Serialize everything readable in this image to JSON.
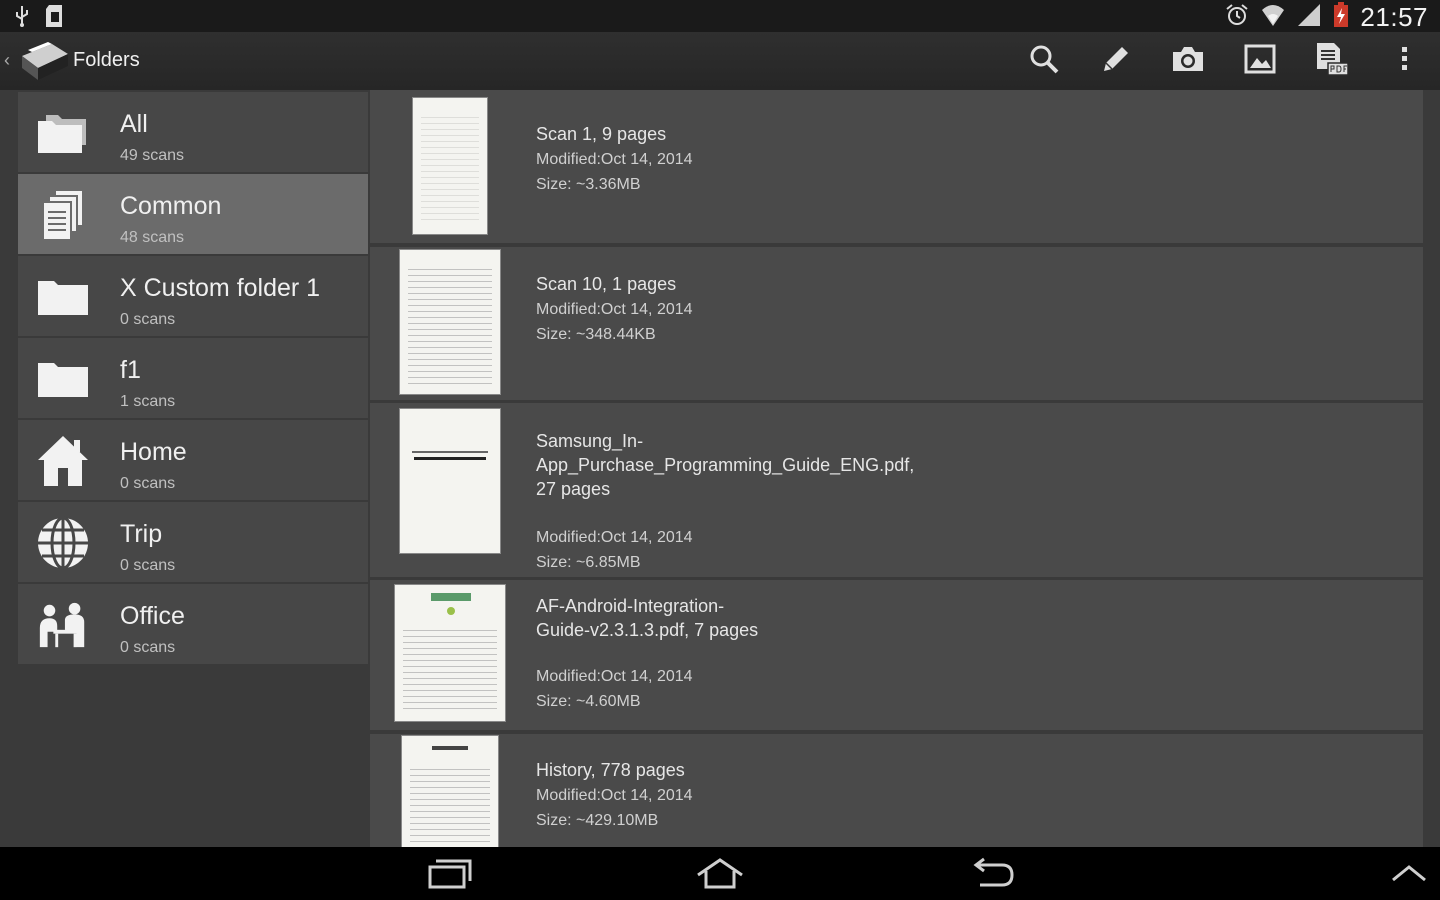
{
  "status": {
    "time": "21:57"
  },
  "app": {
    "title": "Folders"
  },
  "toolbar": {
    "actions": [
      "search-icon",
      "pencil-icon",
      "camera-icon",
      "image-icon",
      "pdf-document-icon",
      "overflow-menu-icon"
    ]
  },
  "folders": [
    {
      "name": "All",
      "count": "49 scans",
      "icon": "folders-icon",
      "selected": false
    },
    {
      "name": "Common",
      "count": "48 scans",
      "icon": "documents-icon",
      "selected": true
    },
    {
      "name": "X Custom folder 1",
      "count": "0 scans",
      "icon": "folder-icon",
      "selected": false
    },
    {
      "name": "f1",
      "count": "1 scans",
      "icon": "folder-icon",
      "selected": false
    },
    {
      "name": "Home",
      "count": "0 scans",
      "icon": "house-icon",
      "selected": false
    },
    {
      "name": "Trip",
      "count": "0 scans",
      "icon": "globe-icon",
      "selected": false
    },
    {
      "name": "Office",
      "count": "0 scans",
      "icon": "office-icon",
      "selected": false
    }
  ],
  "scans": [
    {
      "title": "Scan 1, 9 pages",
      "modified": "Modified:Oct 14, 2014",
      "size": "Size: ~3.36MB"
    },
    {
      "title": "Scan 10, 1 pages",
      "modified": "Modified:Oct 14, 2014",
      "size": "Size: ~348.44KB"
    },
    {
      "title": "Samsung_In-App_Purchase_Programming_Guide_ENG.pdf, 27 pages",
      "modified": "Modified:Oct 14, 2014",
      "size": "Size: ~6.85MB"
    },
    {
      "title": "AF-Android-Integration-Guide-v2.3.1.3.pdf, 7 pages",
      "modified": "Modified:Oct 14, 2014",
      "size": "Size: ~4.60MB"
    },
    {
      "title": "History, 778 pages",
      "modified": "Modified:Oct 14, 2014",
      "size": "Size: ~429.10MB"
    }
  ],
  "colors": {
    "background": "#3a3a3a",
    "row": "#4a4a4a",
    "selected": "#6b6b6b",
    "statusbar": "#1a1a1a"
  }
}
